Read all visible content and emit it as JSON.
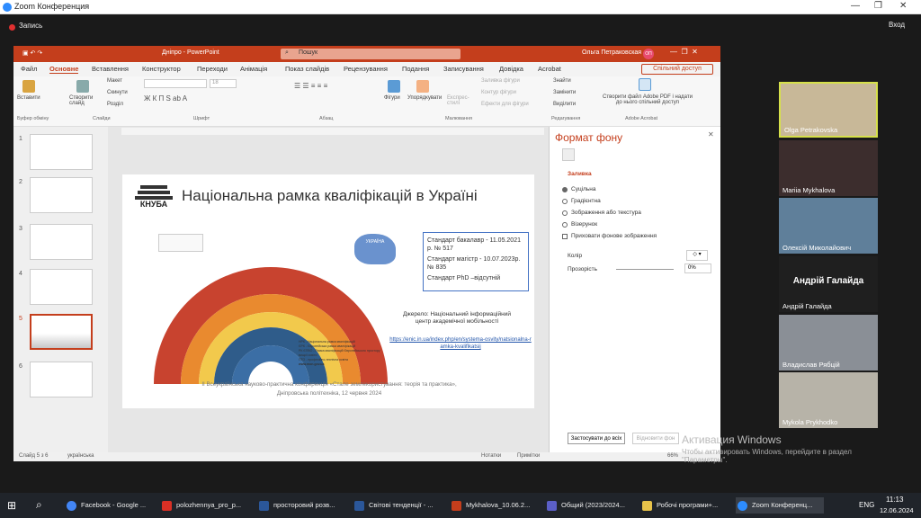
{
  "zoom": {
    "title": "Zoom Конференция",
    "record": "Запись",
    "exit": "Вход"
  },
  "ppt": {
    "doc_title": "Дніпро - PowerPoint",
    "search": "Пошук",
    "user": "Ольга Петраковская",
    "user_initials": "ОП",
    "share": "Спільний доступ",
    "menu": [
      "Файл",
      "Основне",
      "Вставлення",
      "Конструктор",
      "Переходи",
      "Анімація",
      "Показ слайдів",
      "Рецензування",
      "Подання",
      "Записування",
      "Довідка",
      "Acrobat"
    ],
    "ribbon": {
      "paste": "Вставити",
      "clipboard": "Буфер обміну",
      "new_slide": "Створити слайд",
      "layout": "Макет",
      "reset": "Скинути",
      "section": "Розділ",
      "slides": "Слайди",
      "font": "Шрифт",
      "paragraph": "Абзац",
      "shapes": "Фігури",
      "arrange": "Упорядкувати",
      "quick_styles": "Експрес-стилі",
      "fill": "Заливка фігури",
      "outline": "Контур фігури",
      "effects": "Ефекти для фігури",
      "drawing": "Малювання",
      "find": "Знайти",
      "replace": "Замінити",
      "select": "Виділити",
      "editing": "Редагування",
      "adobe": "Створити файл Adobe PDF і надати до нього спільний доступ",
      "adobe_group": "Adobe Acrobat",
      "font_size": "18"
    },
    "slide_numbers": [
      "1",
      "2",
      "3",
      "4",
      "5",
      "6"
    ],
    "slide": {
      "logo": "КНУБА",
      "title": "Національна рамка кваліфікацій в Україні",
      "ukraine": "УКРАЇНА",
      "box_line1": "Стандарт бакалавр - 11.05.2021 р. № 517",
      "box_line2": "Стандарт магістр - 10.07.2023р. № 835",
      "box_line3": "Стандарт PhD –відсутній",
      "source": "Джерело: Національний інформаційний центр академічної мобільності",
      "link": "https://enic.in.ua/index.php/en/systema-osvity/natsionalna-ramka-kvalifikatsij",
      "footer1": "II Всеукраїнська науково-практична конференція «Стале землекористування: теорія та практика»,",
      "footer2": "Дніпровська політехніка, 12 червня 2024",
      "legend": [
        "НРК - Національна рамка кваліфікацій",
        "ЄРК - Європейська рамка кваліфікацій",
        "РК ЄПВО - Рамка кваліфікацій Європейського простору вищої освіти",
        "ПТО - професійно-технічна освіта"
      ],
      "site": "www.mon.gov.ua"
    },
    "pane": {
      "title": "Формат фону",
      "section": "Заливка",
      "options": [
        "Суцільна",
        "Градієнтна",
        "Зображення або текстура",
        "Візерунок"
      ],
      "hide": "Приховати фонове зображення",
      "color": "Колір",
      "transparency": "Прозорість",
      "transparency_val": "0%",
      "apply_all": "Застосувати до всіх",
      "reset": "Відновити фон"
    },
    "status": {
      "slide": "Слайд 5 з 6",
      "lang": "українська",
      "notes": "Нотатки",
      "comments": "Примітки",
      "zoom": "66%"
    }
  },
  "participants": [
    "Olga Petrakovska",
    "Mariia Mykhalova",
    "Олексій Миколайович",
    "Андрій Галайда",
    "Владислав Рябцій",
    "Mykola Prykhodko"
  ],
  "participant_big": "Андрій Галайда",
  "activation": {
    "title": "Активация Windows",
    "text": "Чтобы активировать Windows, перейдите в раздел \"Параметры\"."
  },
  "taskbar": {
    "items": [
      "Facebook - Google ...",
      "polozhennya_pro_p...",
      "просторовий розв...",
      "Світові тенденції - ...",
      "Mykhalova_10.06.2...",
      "Общий (2023/2024...",
      "Робочі програми+...",
      "Zoom Конференц..."
    ],
    "lang": "ENG",
    "time": "11:13",
    "date": "12.06.2024"
  }
}
